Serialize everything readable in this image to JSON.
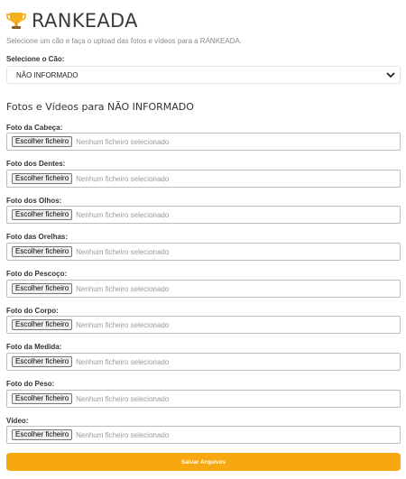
{
  "header": {
    "icon": "trophy-icon",
    "title": "RANKEADA",
    "subtitle": "Selecione um cão e faça o upload das fotos e vídeos para a RANKEADA."
  },
  "dog_select": {
    "label": "Selecione o Cão:",
    "value": "NÃO INFORMADO"
  },
  "section": {
    "title": "Fotos e Vídeos para NÃO INFORMADO"
  },
  "file_button_label": "Escolher ficheiro",
  "file_status": "Nenhum ficheiro selecionado",
  "uploads": [
    {
      "label": "Foto da Cabeça:"
    },
    {
      "label": "Foto dos Dentes:"
    },
    {
      "label": "Foto dos Olhos:"
    },
    {
      "label": "Foto das Orelhas:"
    },
    {
      "label": "Foto do Pescoço:"
    },
    {
      "label": "Foto do Corpo:"
    },
    {
      "label": "Foto da Medida:"
    },
    {
      "label": "Foto do Peso:"
    },
    {
      "label": "Vídeo:"
    }
  ],
  "save_button": "Salvar Arquivos",
  "colors": {
    "accent": "#f7a70f",
    "trophy": "#f2b01e"
  }
}
